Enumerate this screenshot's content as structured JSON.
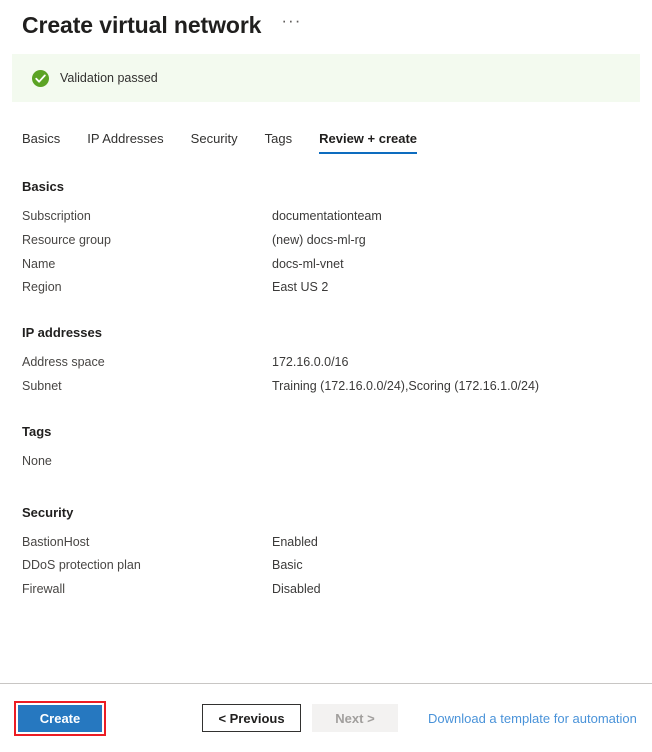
{
  "header": {
    "title": "Create virtual network",
    "more_actions": "···"
  },
  "validation": {
    "icon": "check-circle-icon",
    "message": "Validation passed",
    "background_color": "#f3faef",
    "icon_color": "#5ba324"
  },
  "tabs": [
    {
      "label": "Basics",
      "active": false
    },
    {
      "label": "IP Addresses",
      "active": false
    },
    {
      "label": "Security",
      "active": false
    },
    {
      "label": "Tags",
      "active": false
    },
    {
      "label": "Review + create",
      "active": true
    }
  ],
  "active_tab_underline_color": "#0d6cbf",
  "sections": [
    {
      "title": "Basics",
      "rows": [
        {
          "label": "Subscription",
          "value": "documentationteam"
        },
        {
          "label": "Resource group",
          "value": "(new) docs-ml-rg"
        },
        {
          "label": "Name",
          "value": "docs-ml-vnet"
        },
        {
          "label": "Region",
          "value": "East US 2"
        }
      ]
    },
    {
      "title": "IP addresses",
      "rows": [
        {
          "label": "Address space",
          "value": "172.16.0.0/16"
        },
        {
          "label": "Subnet",
          "value": "Training (172.16.0.0/24),Scoring (172.16.1.0/24)"
        }
      ]
    },
    {
      "title": "Tags",
      "empty_text": "None",
      "rows": []
    },
    {
      "title": "Security",
      "rows": [
        {
          "label": "BastionHost",
          "value": "Enabled"
        },
        {
          "label": "DDoS protection plan",
          "value": "Basic"
        },
        {
          "label": "Firewall",
          "value": "Disabled"
        }
      ]
    }
  ],
  "footer": {
    "create_label": "Create",
    "create_color": "#2678c0",
    "create_highlight_color": "#ec1c24",
    "previous_label": "< Previous",
    "next_label": "Next >",
    "next_disabled": true,
    "download_link_label": "Download a template for automation",
    "download_link_color": "#4a93d9"
  }
}
